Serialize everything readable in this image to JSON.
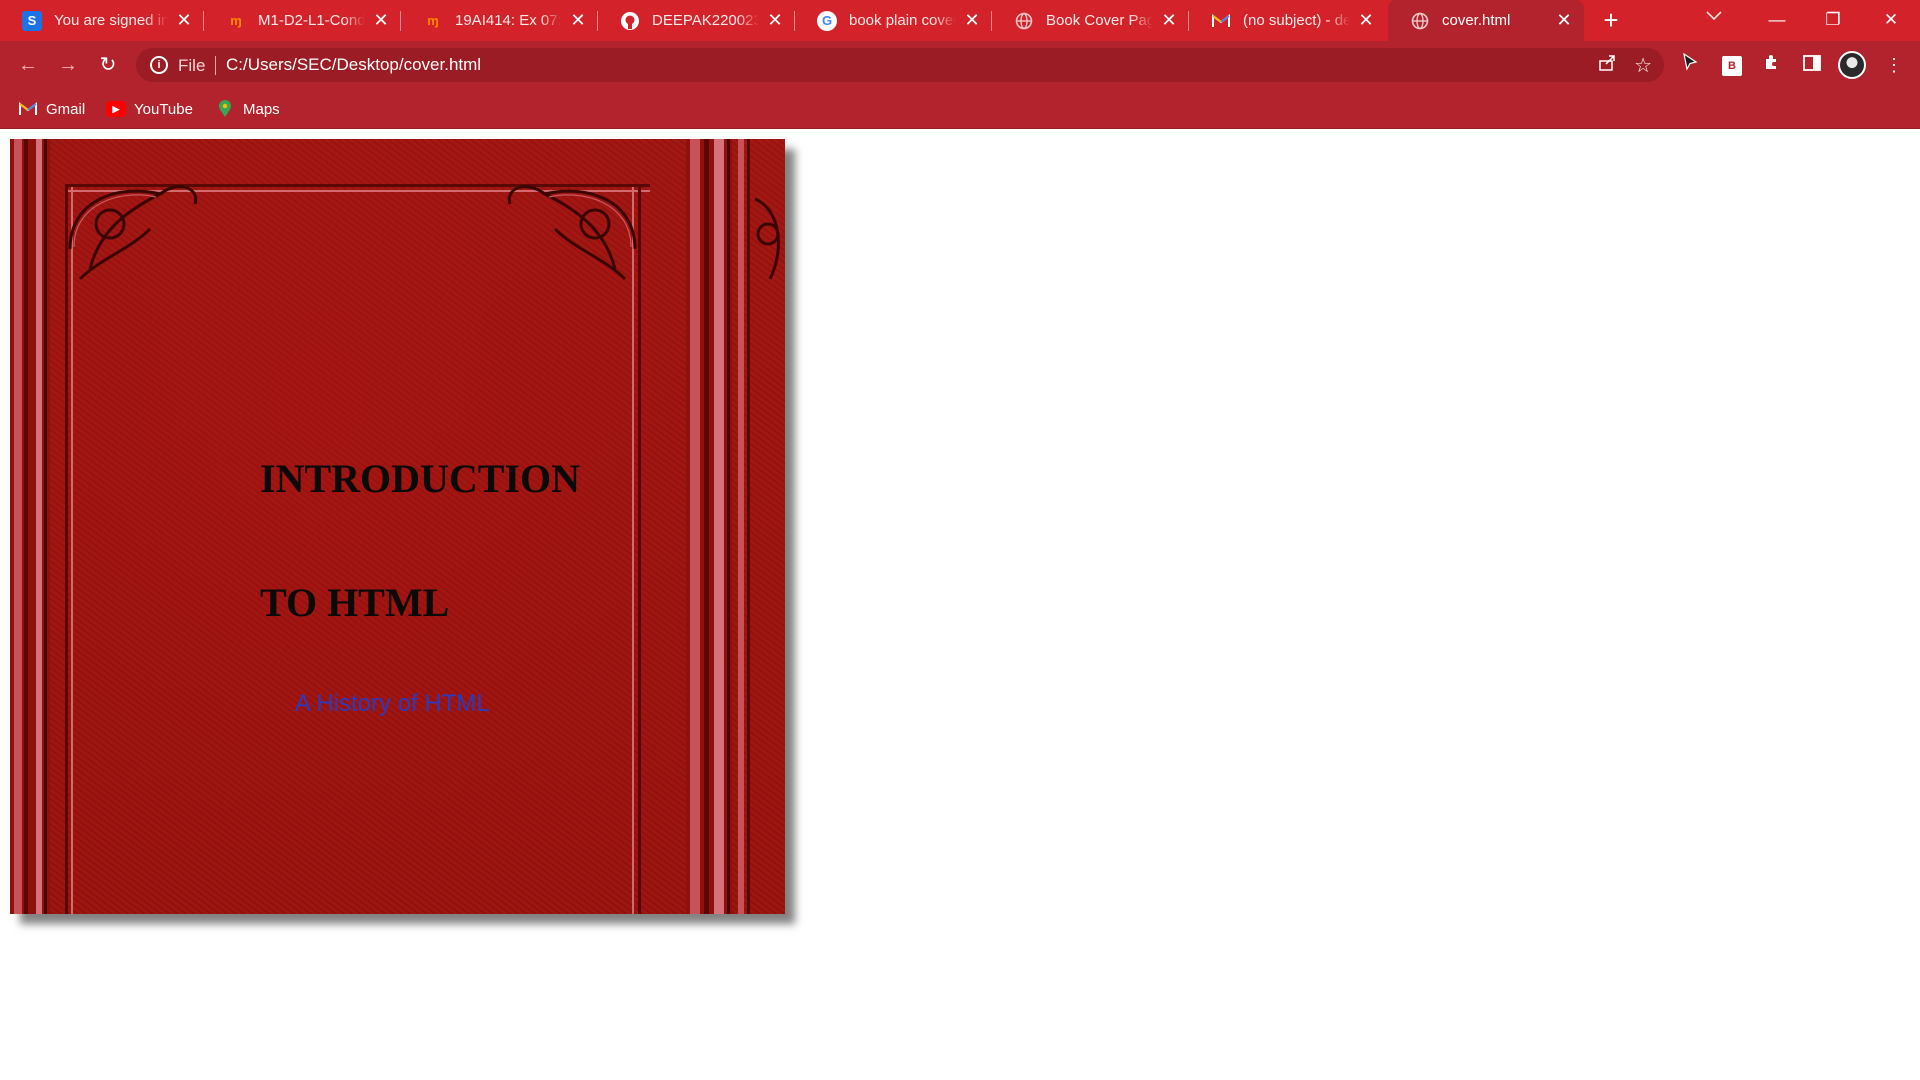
{
  "browser": {
    "tabs": [
      {
        "title": "You are signed in",
        "favicon": "skillrack-icon",
        "active": false
      },
      {
        "title": "M1-D2-L1-Conditi",
        "favicon": "moodle-icon",
        "active": false
      },
      {
        "title": "19AI414: Ex 07: D",
        "favicon": "moodle-icon",
        "active": false
      },
      {
        "title": "DEEPAK2200233/",
        "favicon": "github-icon",
        "active": false
      },
      {
        "title": "book plain cover",
        "favicon": "google-icon",
        "active": false
      },
      {
        "title": "Book Cover Page",
        "favicon": "globe-icon",
        "active": false
      },
      {
        "title": "(no subject) - dee",
        "favicon": "gmail-icon",
        "active": false
      },
      {
        "title": "cover.html",
        "favicon": "globe-icon",
        "active": true
      }
    ],
    "address": {
      "scheme": "File",
      "url": "C:/Users/SEC/Desktop/cover.html"
    },
    "bookmarks": [
      {
        "label": "Gmail",
        "icon": "gmail-icon"
      },
      {
        "label": "YouTube",
        "icon": "youtube-icon"
      },
      {
        "label": "Maps",
        "icon": "maps-icon"
      }
    ],
    "theme_color": "#d3222a"
  },
  "cover": {
    "title_line1": "INTRODUCTION",
    "title_line2": "TO HTML",
    "subtitle": "A History of HTML",
    "cover_color": "#9e120e",
    "subtitle_color": "#2a3bbd"
  }
}
